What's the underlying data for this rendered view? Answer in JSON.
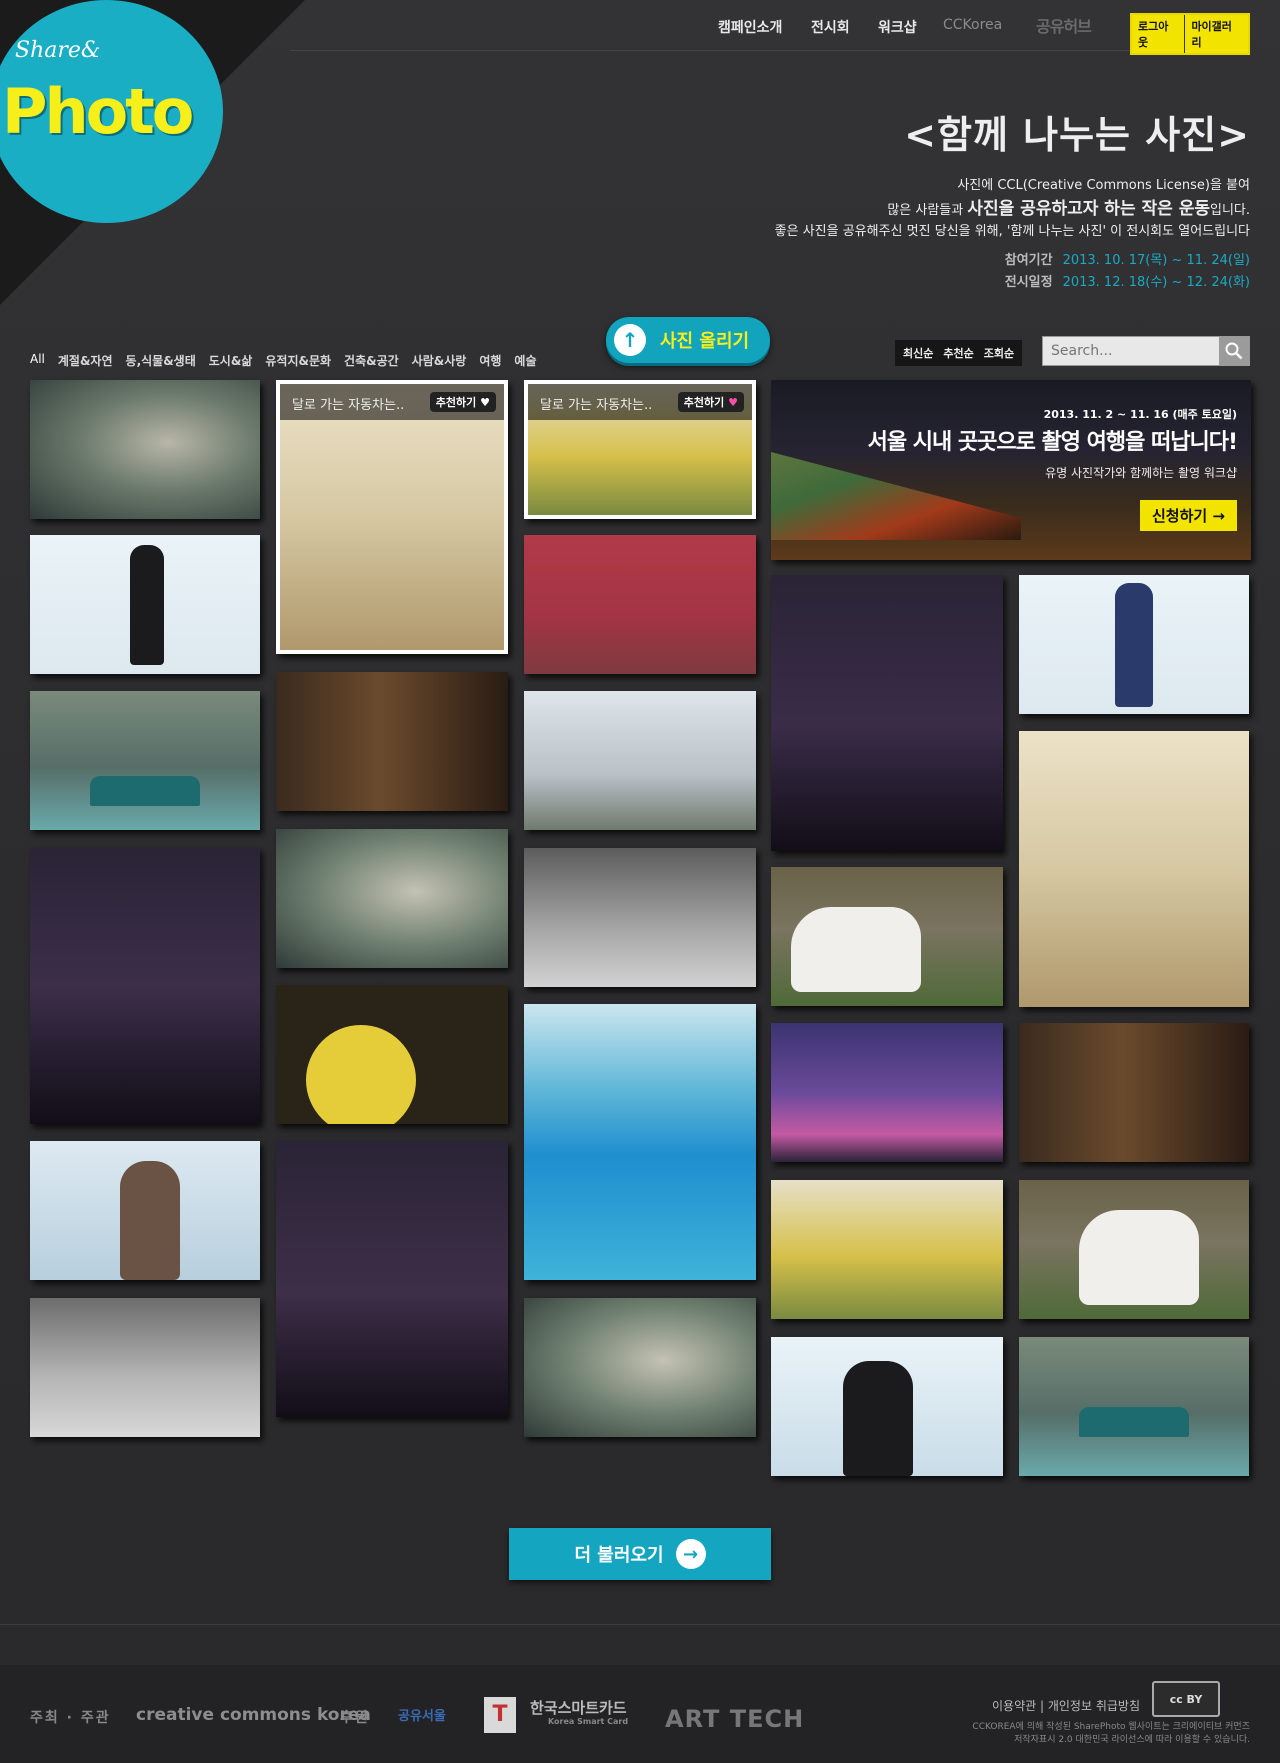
{
  "nav": {
    "items": [
      "캠페인소개",
      "전시회",
      "워크샵",
      "CCKorea"
    ],
    "hub": "공유허브",
    "logout": "로그아웃",
    "mygallery": "마이갤러리"
  },
  "logo": {
    "share": "Share&",
    "photo": "Photo"
  },
  "hero": {
    "title": "<함께 나누는 사진>",
    "line1": "사진에 CCL(Creative Commons License)을 붙여",
    "line2_a": "많은 사람들과 ",
    "line2_b": "사진을 공유하고자 하는 작은 운동",
    "line2_c": "입니다.",
    "line3": "좋은 사진을 공유해주신 멋진 당신을 위해,  '함께 나누는 사진' 이 전시회도 열어드립니다",
    "period_label": "참여기간",
    "period_value": "2013. 10. 17(목) ~ 11. 24(일)",
    "exhibit_label": "전시일정",
    "exhibit_value": "2013. 12. 18(수) ~ 12. 24(화)"
  },
  "upload": {
    "label": "사진 올리기"
  },
  "categories": [
    "All",
    "계절&자연",
    "동,식물&생태",
    "도시&삶",
    "유적지&문화",
    "건축&공간",
    "사람&사랑",
    "여행",
    "예술"
  ],
  "sort": [
    "최신순",
    "추천순",
    "조회순"
  ],
  "search": {
    "placeholder": "Search..."
  },
  "cards": {
    "c1": {
      "title": "달로 가는 자동차는..",
      "button": "추천하기",
      "heart": "♥"
    },
    "c2": {
      "title": "달로 가는 자동차는..",
      "button": "추천하기",
      "heart": "♥"
    }
  },
  "banner": {
    "date": "2013. 11. 2 ~ 11. 16 (매주 토요일)",
    "title": "서울 시내 곳곳으로 촬영 여행을 떠납니다!",
    "sub": "유명 사진작가와 함께하는 촬영 워크샵",
    "cta": "신청하기 →"
  },
  "more": {
    "label": "더 불러오기"
  },
  "footer": {
    "organizer": "주최 · 주관",
    "cc_logo": "creative commons korea",
    "sponsor": "후원",
    "seoul_logo": "공유서울",
    "tmoney_logo": "한국스마트카드",
    "tmoney_sub": "Korea Smart Card",
    "arttech_logo": "ART TECH",
    "terms": "이용약관",
    "privacy": "개인정보 취급방침",
    "notice1": "CCKOREA에 의해 작성된 SharePhoto 웹사이트는 크리에이티브 커먼즈",
    "notice2": "저작자표시 2.0 대한민국 라이선스에 따라 이용할 수 있습니다.",
    "cc_badge": "cc BY"
  }
}
